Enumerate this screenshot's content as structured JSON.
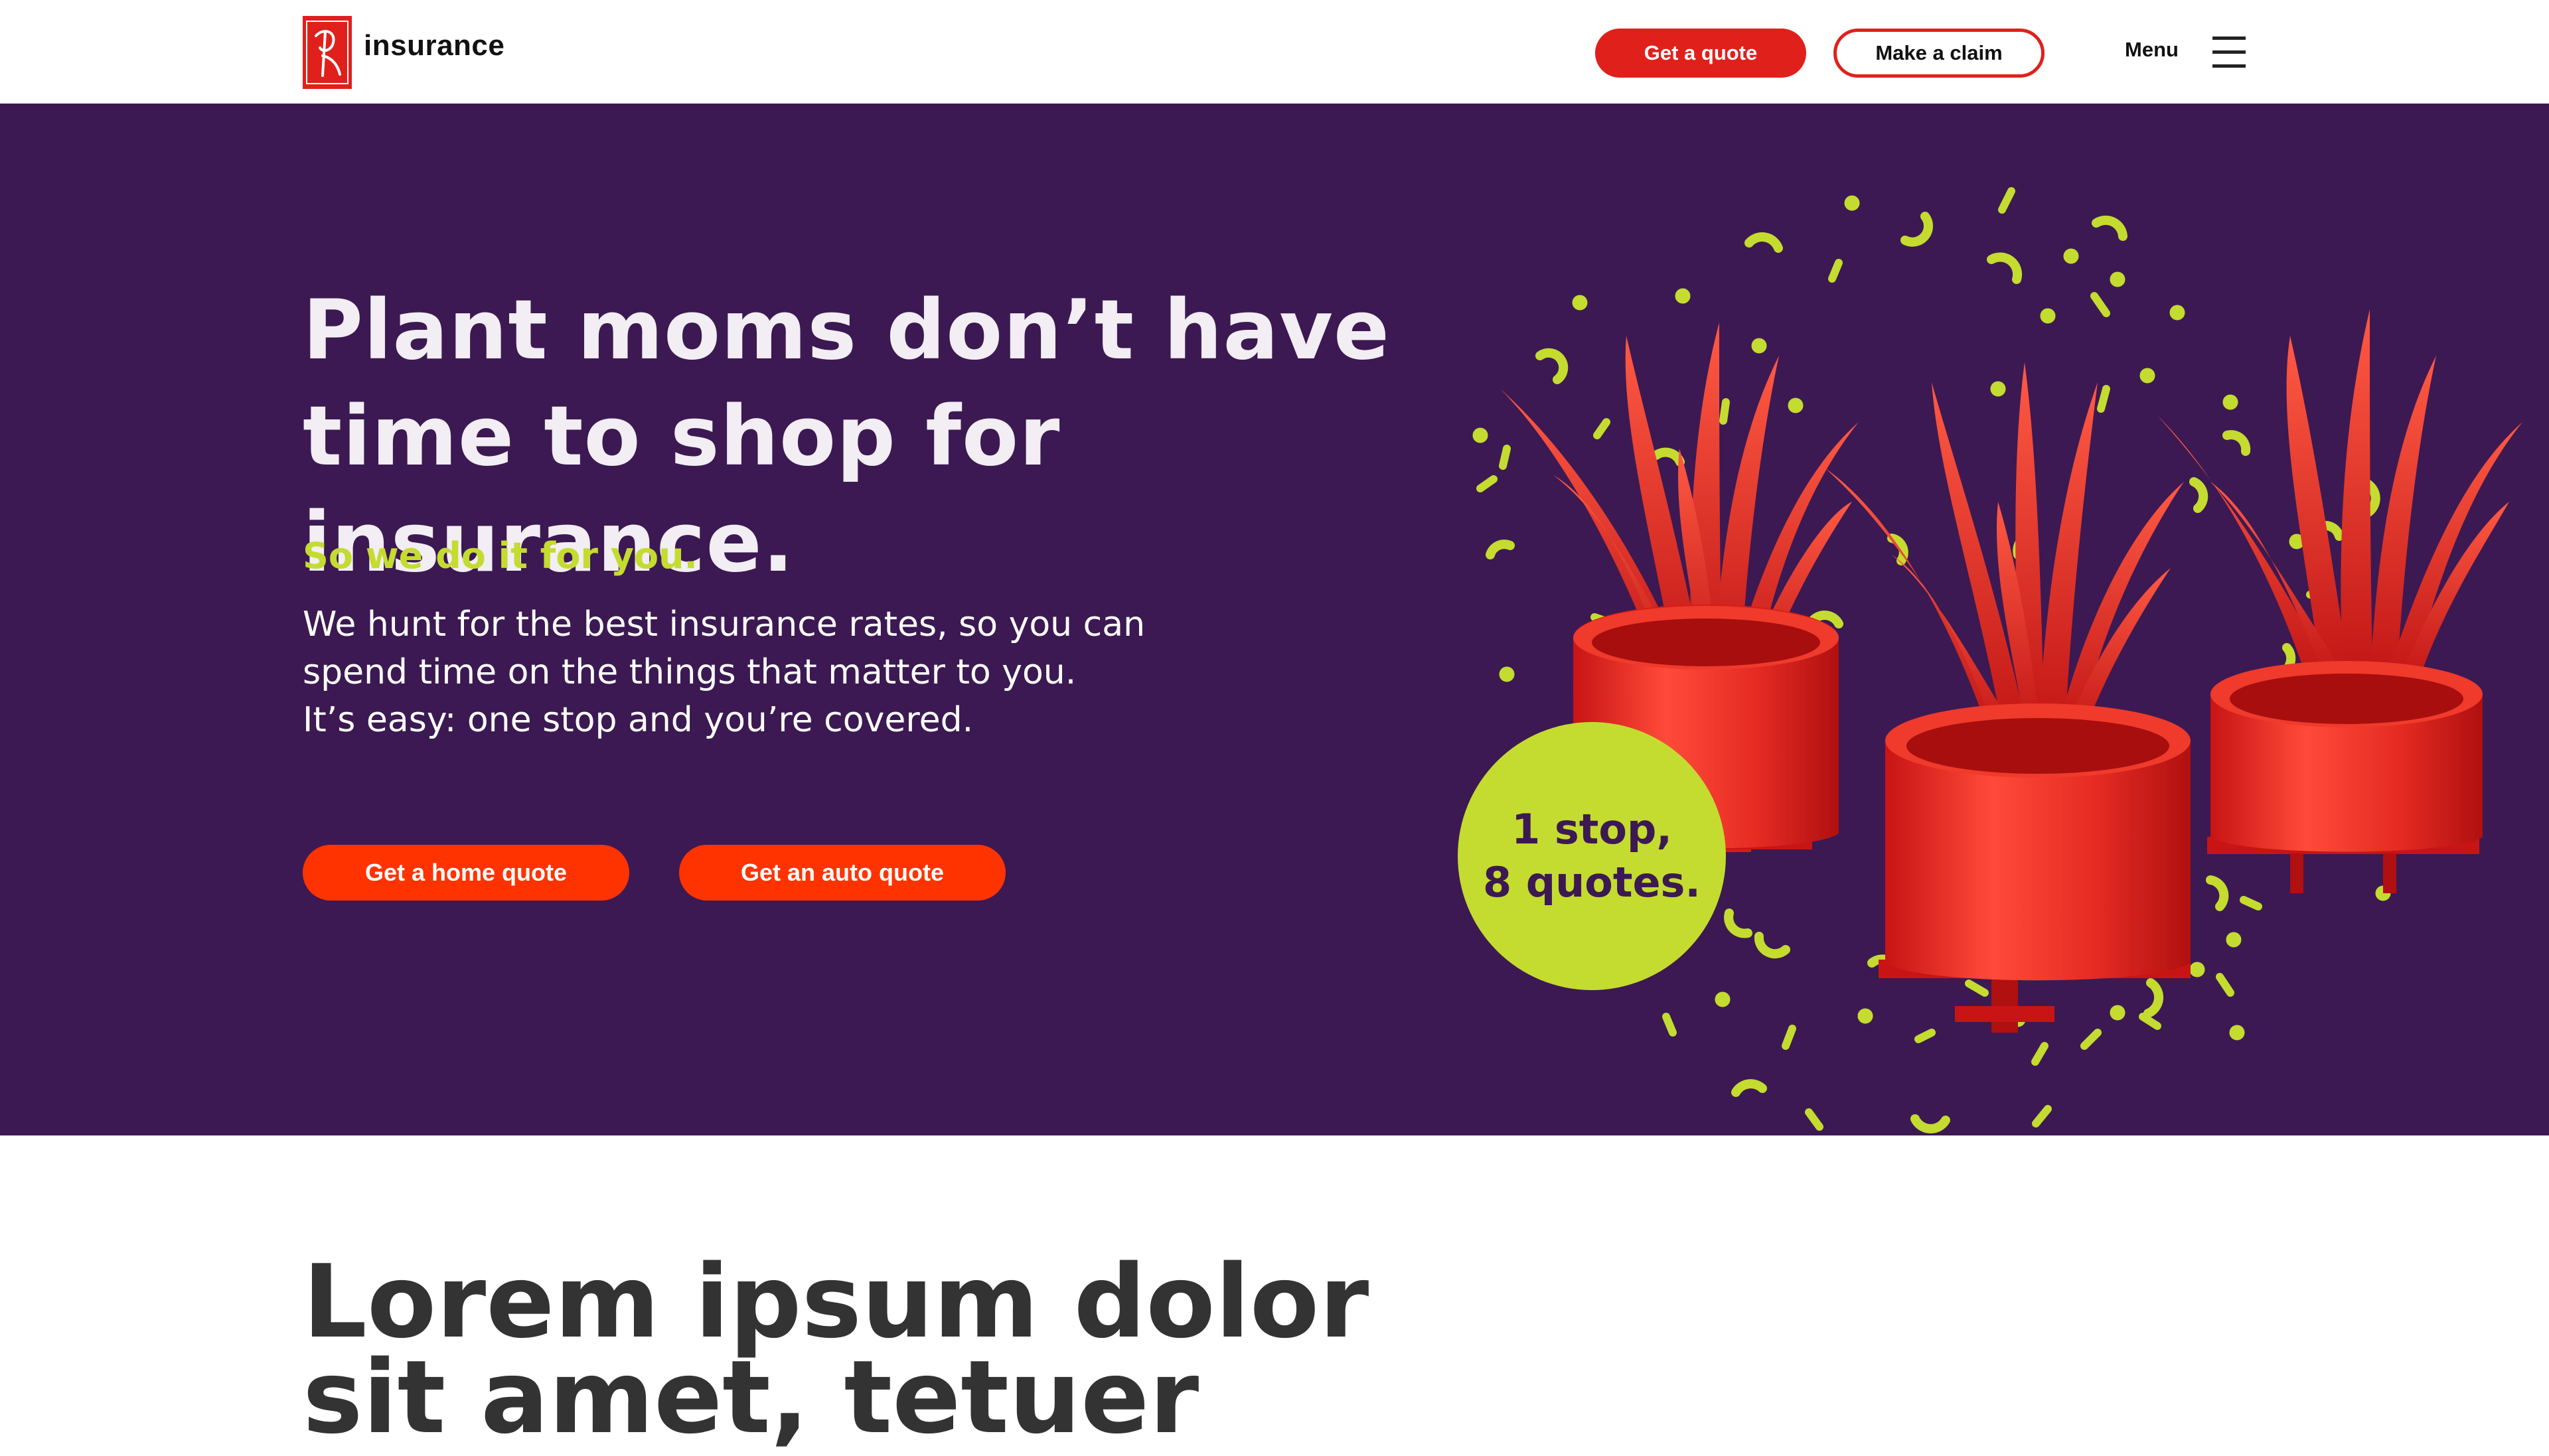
{
  "header": {
    "brand_name": "insurance",
    "quote_button": "Get a quote",
    "claim_button": "Make a claim",
    "menu_label": "Menu"
  },
  "hero": {
    "title_line1": "Plant moms don’t have",
    "title_line2": "time to shop for insurance.",
    "subtitle": "So we do it for you.",
    "body_line1": "We hunt for the best insurance rates, so you can",
    "body_line2": "spend time on the things that matter to you.",
    "body_line3": "It’s easy: one stop and you’re covered.",
    "home_button": "Get a home quote",
    "auto_button": "Get an auto quote",
    "badge_line1": "1 stop,",
    "badge_line2": "8 quotes."
  },
  "section": {
    "title_line1": "Lorem ipsum dolor",
    "title_line2": "sit amet, tetuer"
  },
  "colors": {
    "brand_red": "#e0201b",
    "cta_orange": "#ff3300",
    "hero_purple": "#3c1952",
    "accent_lime": "#c4dc2f"
  },
  "icons": [
    "brand-logo-icon",
    "menu-hamburger-icon",
    "plant-illustration"
  ]
}
